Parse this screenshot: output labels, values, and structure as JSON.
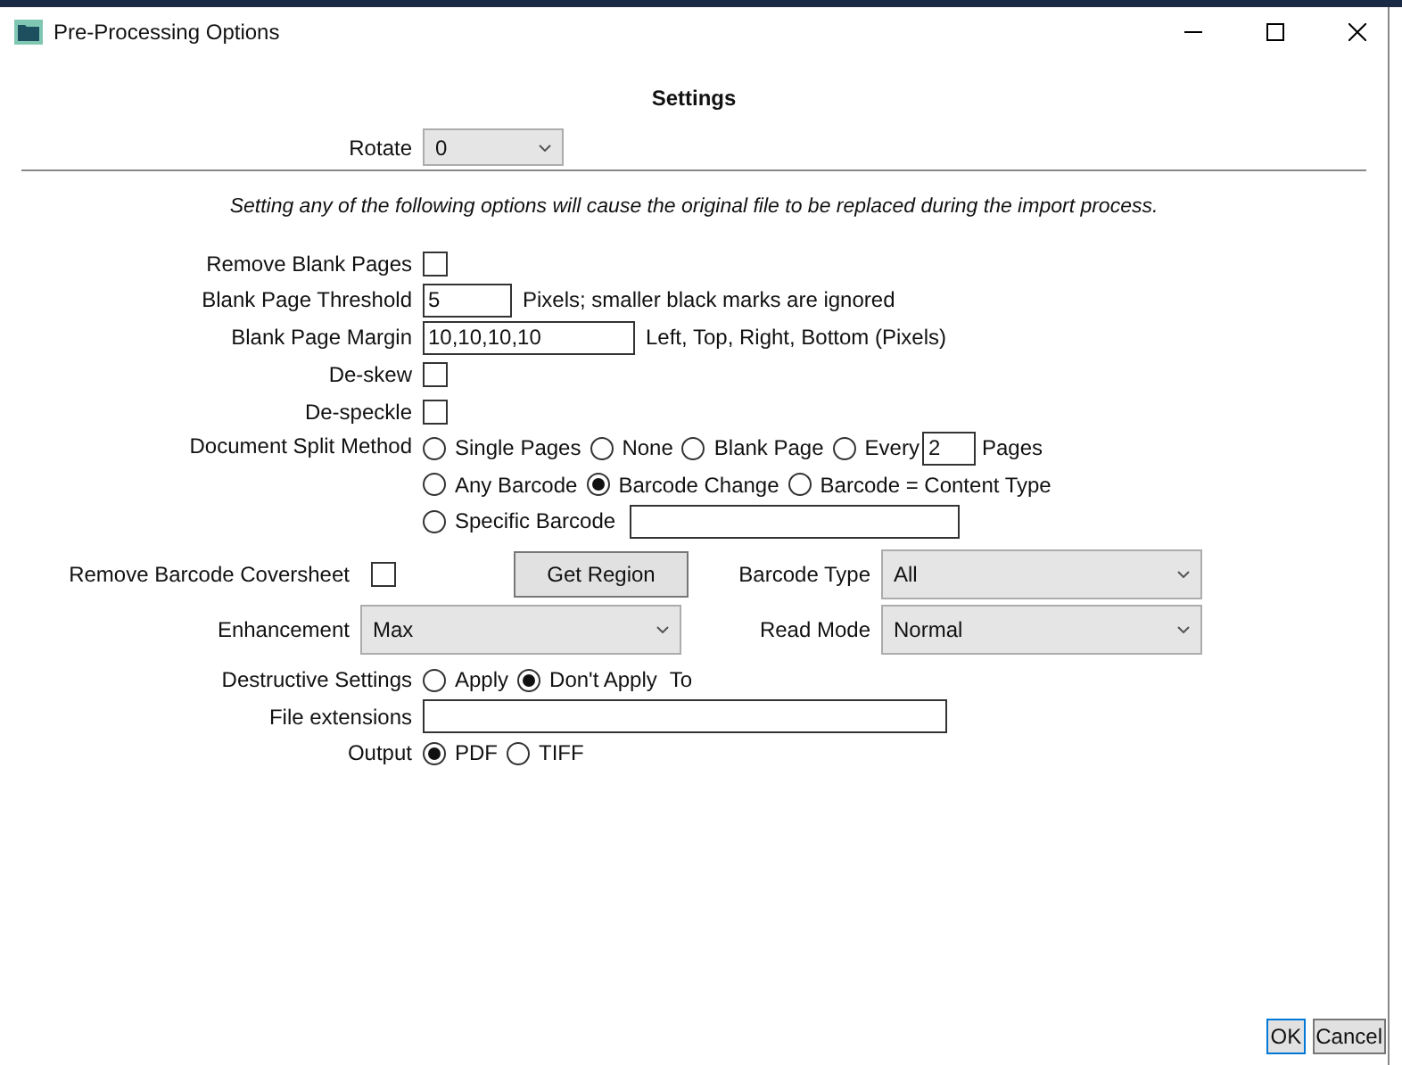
{
  "window": {
    "title": "Pre-Processing Options"
  },
  "heading": "Settings",
  "rotate": {
    "label": "Rotate",
    "value": "0"
  },
  "notice": "Setting any of the following options will cause the original file to be replaced during the import process.",
  "rows": [
    {
      "kind": "checkbox",
      "label": "Remove Blank Pages",
      "checked": false
    },
    {
      "kind": "short-text",
      "label": "Blank Page Threshold",
      "value": "5",
      "hint": "Pixels; smaller black marks are ignored"
    },
    {
      "kind": "text",
      "label": "Blank Page Margin",
      "value": "10,10,10,10",
      "hint": "Left, Top, Right, Bottom (Pixels)"
    },
    {
      "kind": "checkbox",
      "label": "De-skew",
      "checked": false
    },
    {
      "kind": "checkbox",
      "label": "De-speckle",
      "checked": false
    },
    {
      "kind": "radios",
      "label": "Document Split Method",
      "lines": [
        [
          {
            "kind": "plain",
            "label": "Single Pages",
            "selected": false
          },
          {
            "kind": "plain",
            "label": "None",
            "selected": false
          },
          {
            "kind": "plain",
            "label": "Blank Page",
            "selected": false
          },
          {
            "kind": "count",
            "label": "Every",
            "selected": false,
            "value": "2",
            "suffix": "Pages"
          }
        ],
        [
          {
            "kind": "plain",
            "label": "Any Barcode",
            "selected": false
          },
          {
            "kind": "plain",
            "label": "Barcode Change",
            "selected": true
          },
          {
            "kind": "plain",
            "label": "Barcode = Content Type",
            "selected": false
          }
        ],
        [
          {
            "kind": "field",
            "label": "Specific Barcode",
            "selected": false
          }
        ]
      ]
    }
  ],
  "barcode": {
    "coversheet": {
      "label": "Remove Barcode Coversheet",
      "checked": false
    },
    "get_region": "Get Region",
    "barcode_type": {
      "label": "Barcode Type",
      "value": "All"
    },
    "enhancement": {
      "label": "Enhancement",
      "value": "Max"
    },
    "read_mode": {
      "label": "Read Mode",
      "value": "Normal"
    }
  },
  "destructive": {
    "label": "Destructive Settings",
    "options": [
      {
        "label": "Apply",
        "selected": false
      },
      {
        "label": "Don't Apply",
        "selected": true
      }
    ],
    "suffix": "To"
  },
  "file_extensions": {
    "label": "File extensions"
  },
  "output": {
    "label": "Output",
    "options": [
      {
        "label": "PDF",
        "selected": true
      },
      {
        "label": "TIFF",
        "selected": false
      }
    ]
  },
  "buttons": [
    {
      "label": "OK",
      "default": true
    },
    {
      "label": "Cancel",
      "default": false
    }
  ]
}
